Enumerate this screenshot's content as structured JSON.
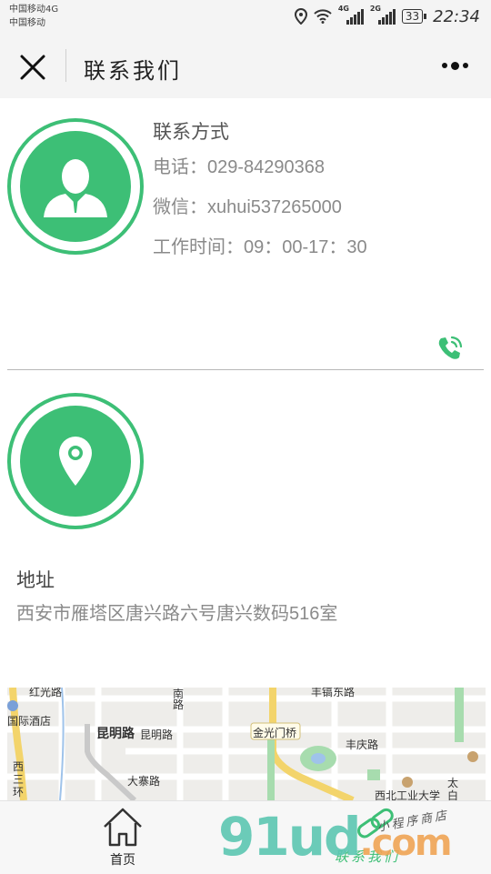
{
  "status_bar": {
    "carrier_line1": "中国移动4G",
    "carrier_line2": "中国移动",
    "net1": "4G",
    "net2": "2G",
    "battery": "33",
    "time": "22:34"
  },
  "nav": {
    "title": "联系我们"
  },
  "contact": {
    "heading": "联系方式",
    "phone": "电话：029-84290368",
    "wechat": "微信：xuhui537265000",
    "hours": "工作时间：09：00-17：30"
  },
  "address": {
    "label": "地址",
    "text": "西安市雁塔区唐兴路六号唐兴数码516室"
  },
  "map": {
    "labels": {
      "hongguang": "红光路",
      "nan": "南",
      "lu": "路",
      "hotel": "国际酒店",
      "kunming_bold": "昆明路",
      "kunming": "昆明路",
      "fengdeng": "丰镐东路",
      "jinguang": "金光门桥",
      "fengqing": "丰庆路",
      "dazhai": "大寨路",
      "xisan": "西",
      "san": "三",
      "huan": "环",
      "nwpu": "西北工业大学",
      "tai": "太",
      "bai": "白"
    }
  },
  "tabbar": {
    "home": "首页",
    "contact": "联系我们"
  },
  "watermark": {
    "main": "91ud",
    "com": ".com",
    "sub": "小程序商店"
  },
  "colors": {
    "accent": "#3dbf76",
    "text_gray": "#8a8a8a",
    "heading": "#555555",
    "bar_bg": "#f4f4f4"
  }
}
